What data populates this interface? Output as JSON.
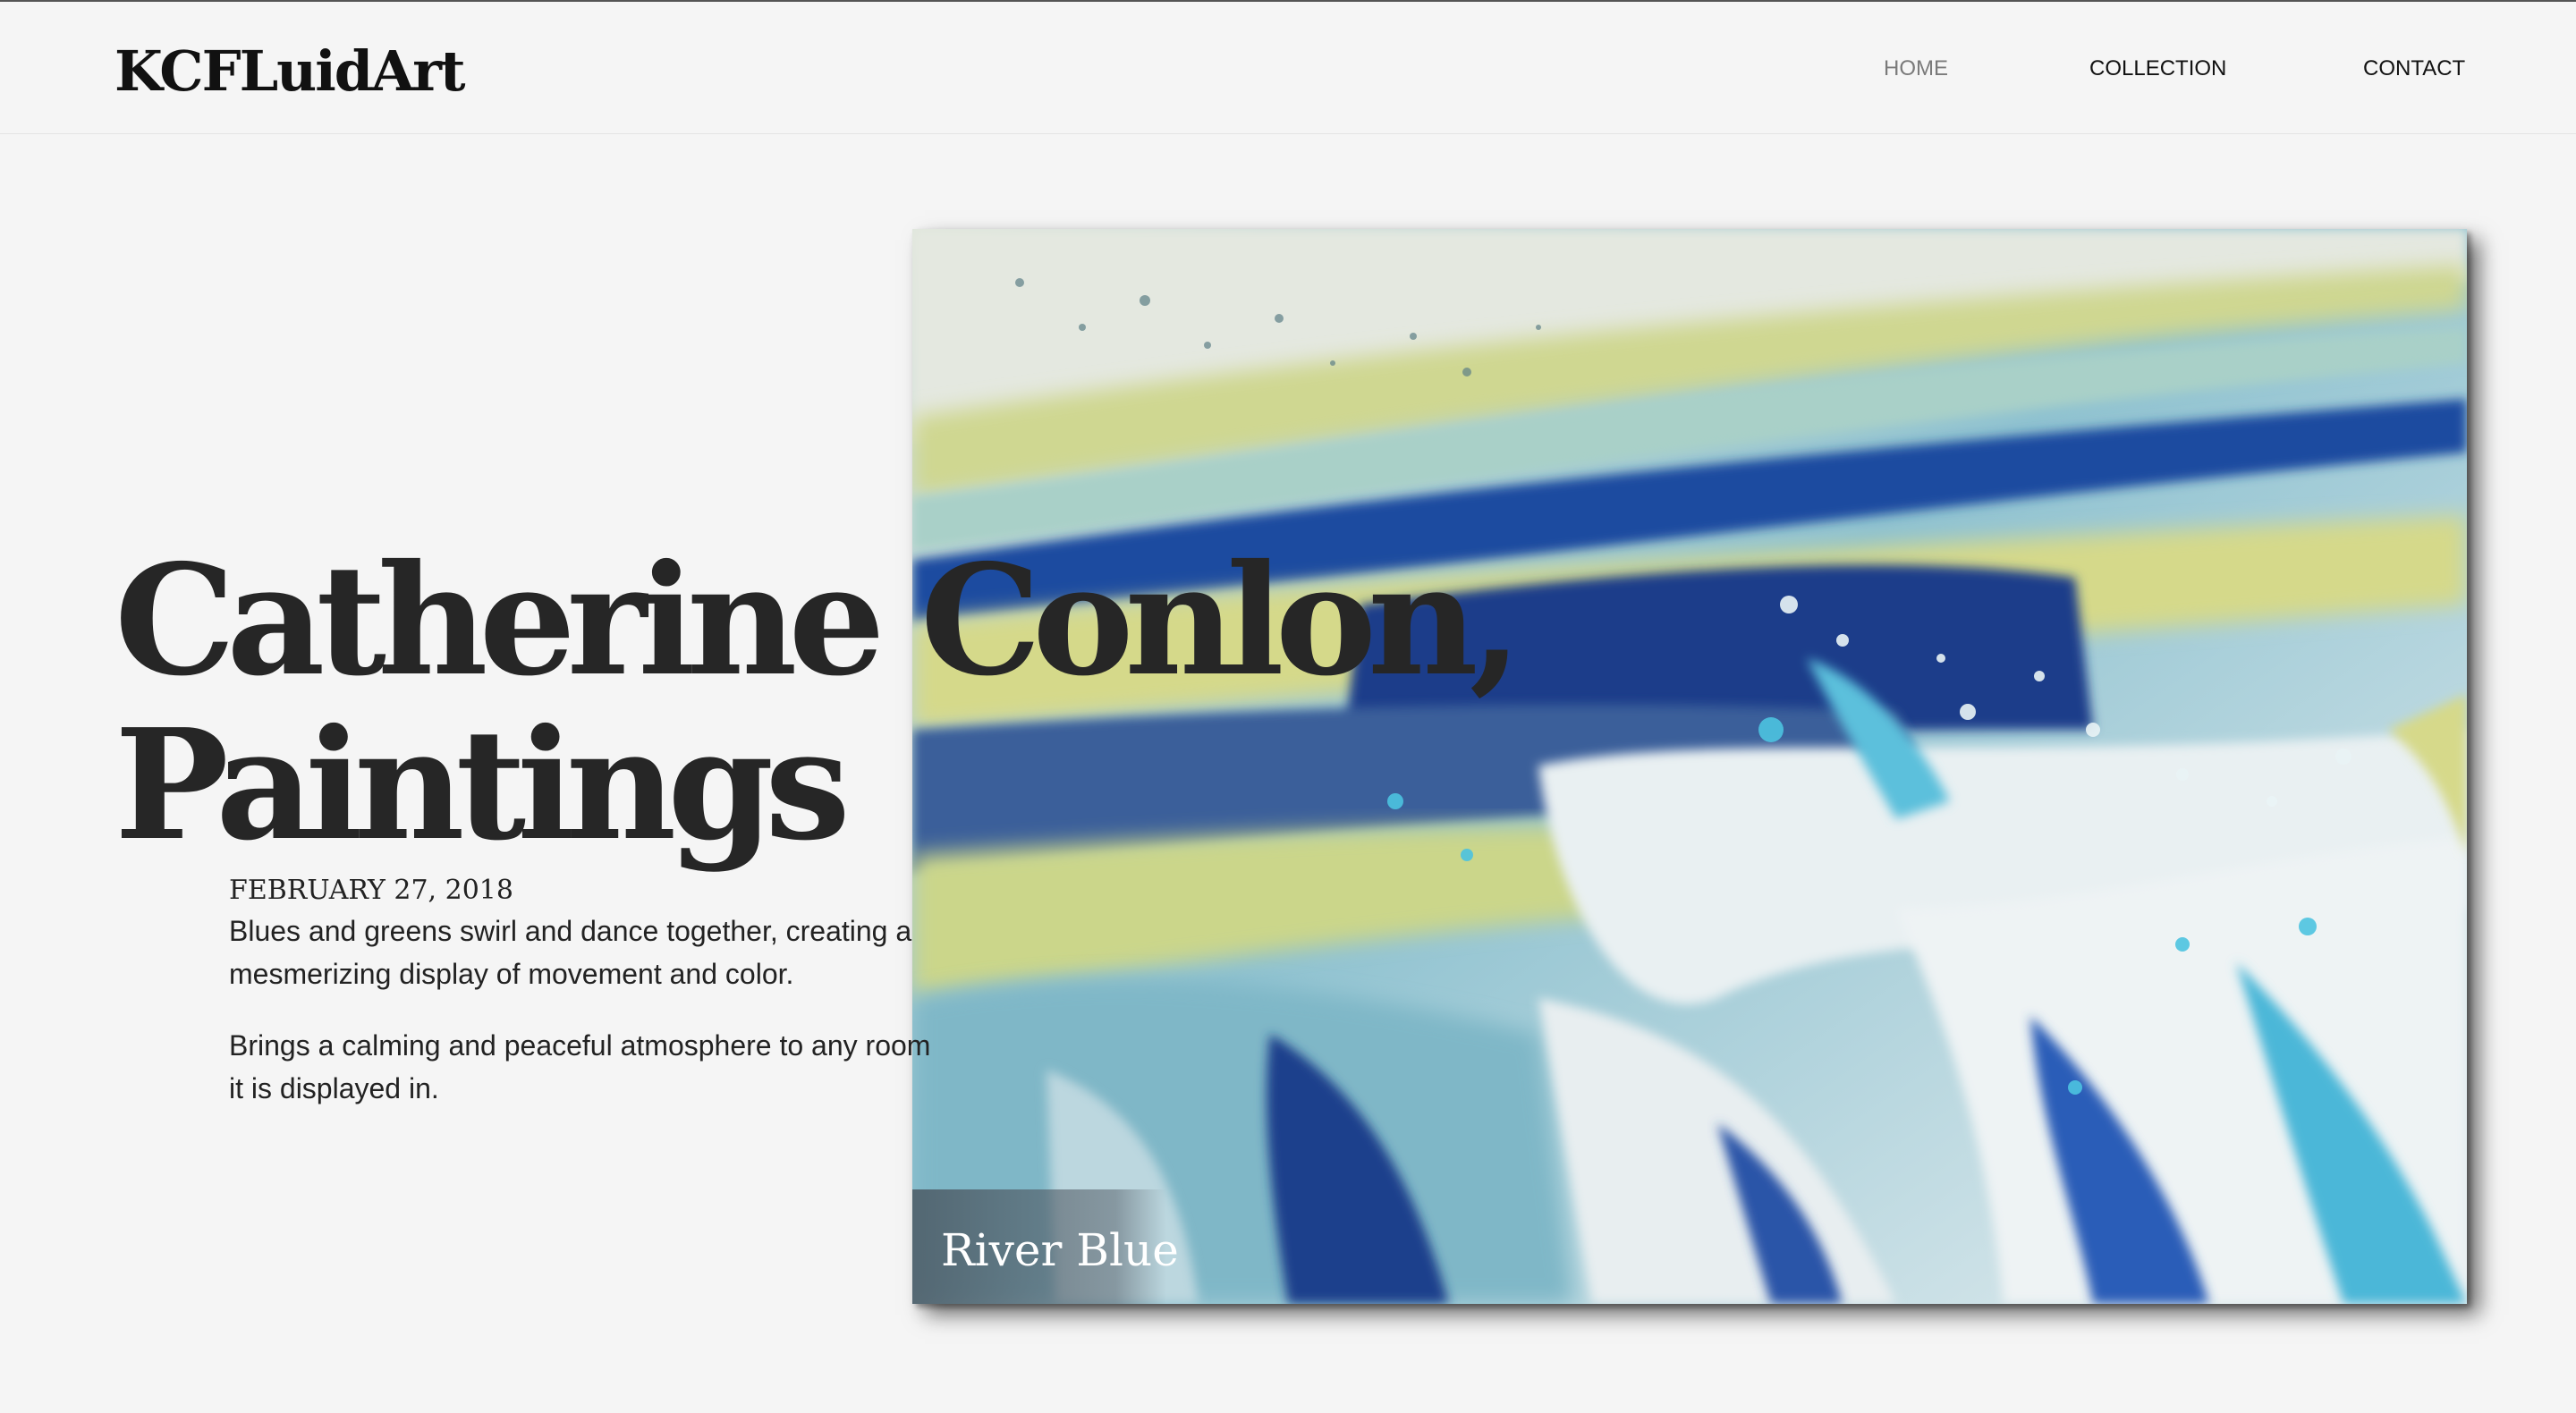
{
  "brand": {
    "logo": "KCFLuidArt"
  },
  "nav": {
    "items": [
      {
        "label": "HOME",
        "active": true
      },
      {
        "label": "COLLECTION",
        "active": false
      },
      {
        "label": "CONTACT",
        "active": false
      }
    ]
  },
  "hero": {
    "title_line1": "Catherine Conlon,",
    "title_line2": "Paintings"
  },
  "post": {
    "date": "FEBRUARY 27, 2018",
    "paragraph1": "Blues and greens swirl and dance together, creating a mesmerizing display of movement and color.",
    "paragraph2": "Brings a calming and peaceful atmosphere to any room it is displayed in."
  },
  "painting": {
    "title": "River Blue"
  },
  "colors": {
    "background": "#f5f5f5",
    "text": "#262626",
    "nav_active": "#7a7a7a",
    "paint_navy": "#1d3f8c",
    "paint_teal": "#5cc0dc",
    "paint_yellow": "#d6d98a",
    "paint_white": "#eef3f4"
  }
}
